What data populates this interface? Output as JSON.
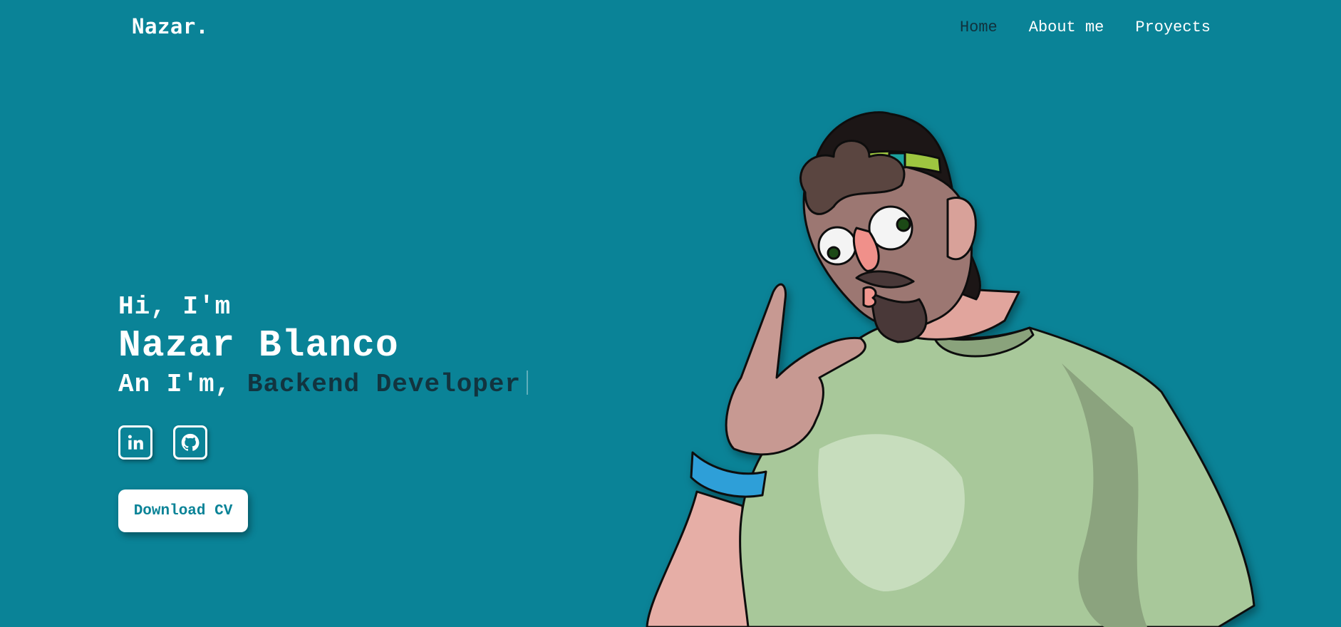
{
  "brand": "Nazar.",
  "nav": {
    "items": [
      {
        "label": "Home",
        "active": true
      },
      {
        "label": "About me",
        "active": false
      },
      {
        "label": "Proyects",
        "active": false
      }
    ]
  },
  "hero": {
    "greeting": "Hi, I'm",
    "name": "Nazar Blanco",
    "role_prefix": "An I'm,",
    "role_typed": "Backend Developer",
    "socials": [
      {
        "icon": "linkedin-icon"
      },
      {
        "icon": "github-icon"
      }
    ],
    "cta_label": "Download CV"
  },
  "colors": {
    "background": "#0a8397",
    "active_nav": "#10323d",
    "typed_text": "#12343f",
    "button_text": "#0a8397"
  }
}
